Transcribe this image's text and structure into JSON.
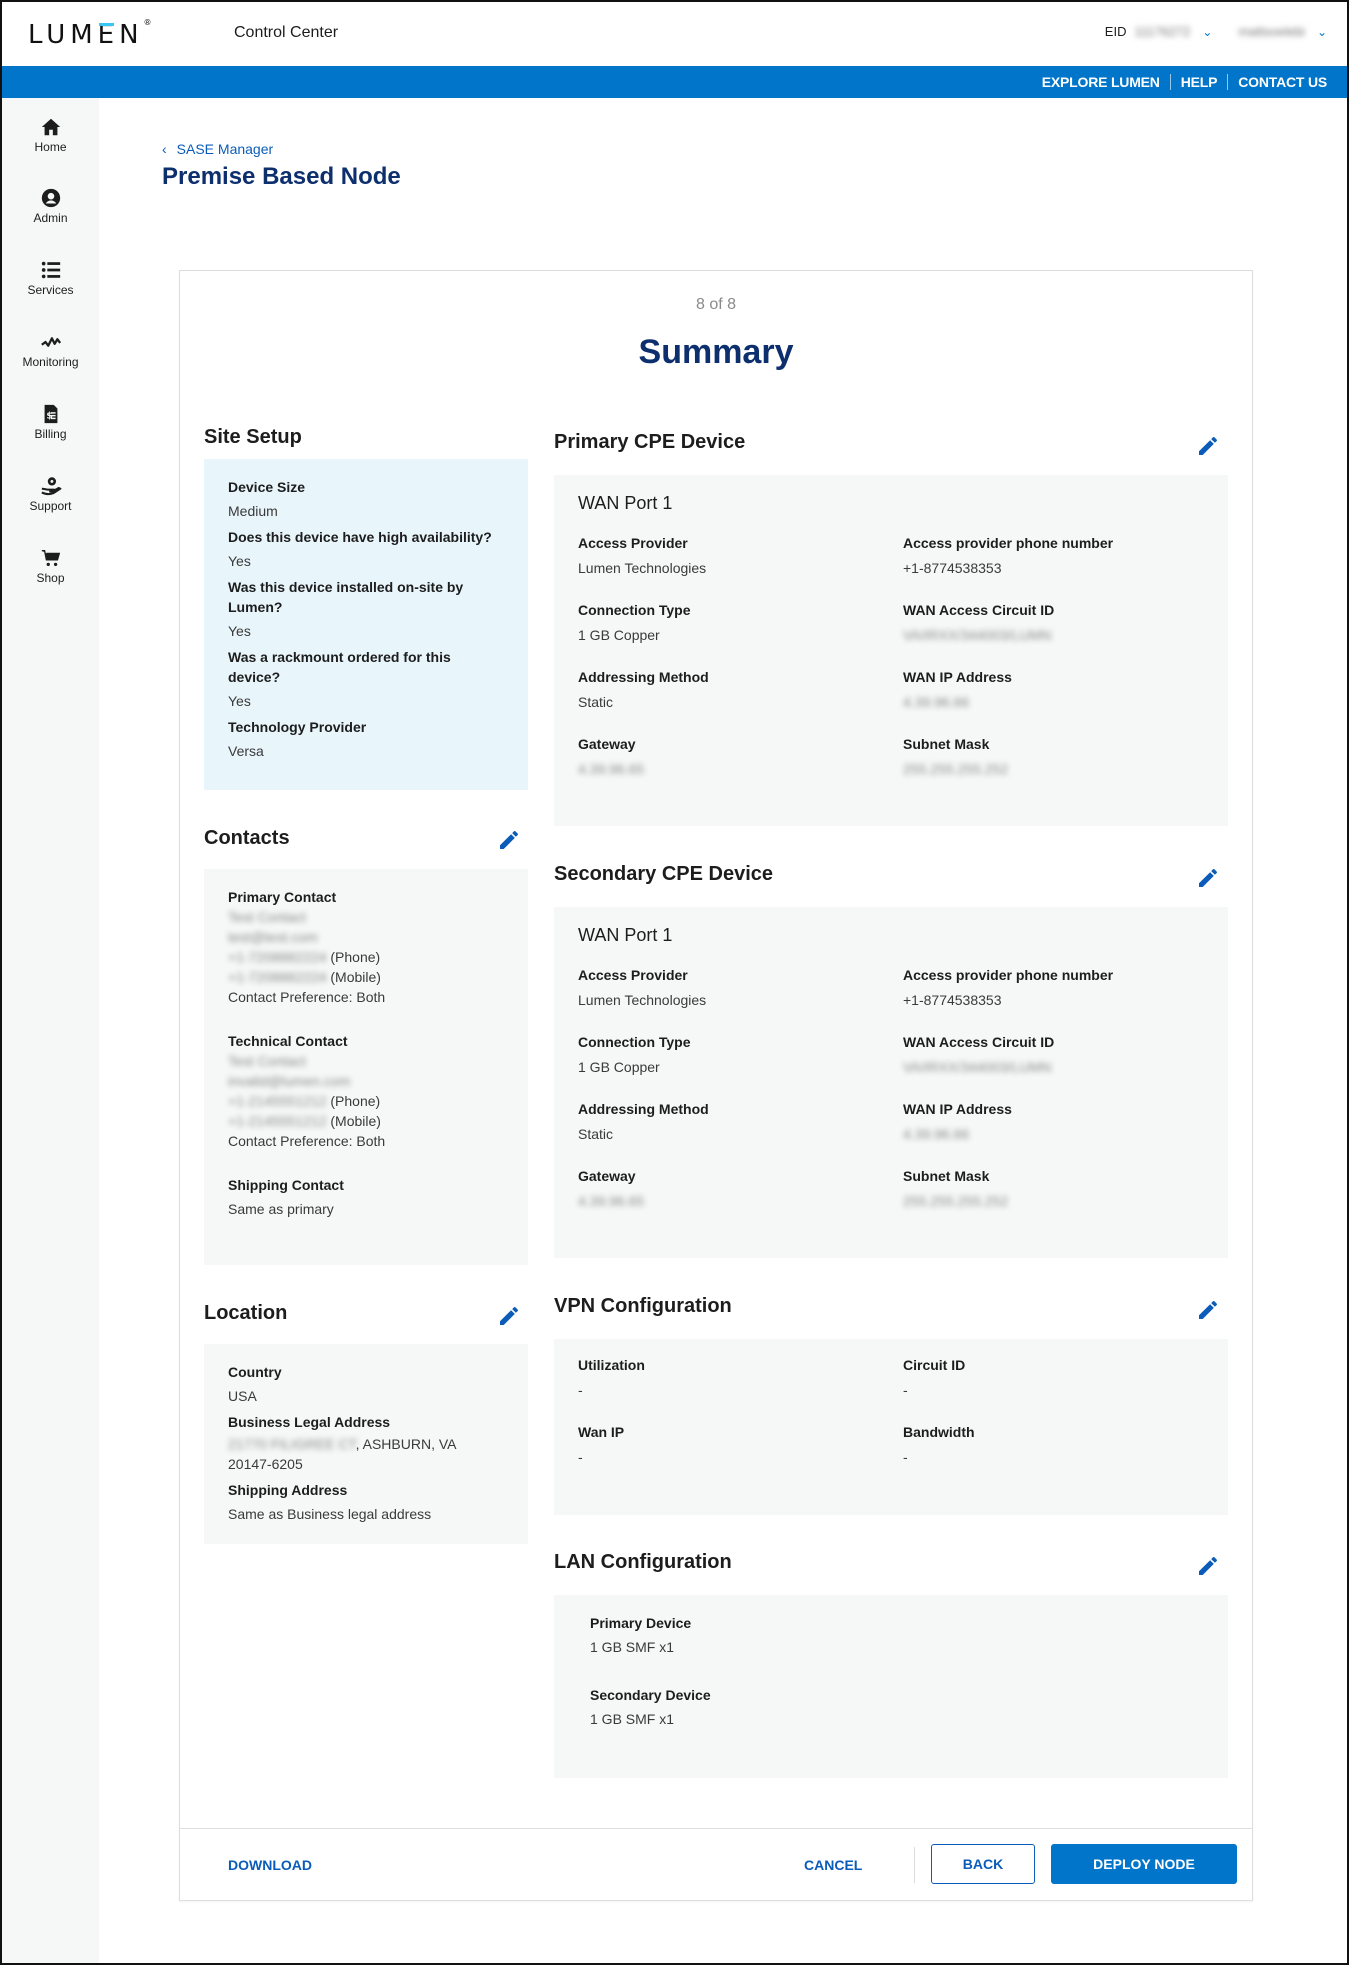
{
  "header": {
    "logo": "LUMEN",
    "app_name": "Control Center",
    "eid_label": "EID",
    "eid_value": "11176272",
    "user_name": "mattsoelebi"
  },
  "topnav": {
    "links": [
      "EXPLORE LUMEN",
      "HELP",
      "CONTACT US"
    ]
  },
  "sidebar": {
    "items": [
      {
        "label": "Home",
        "icon": "home-icon"
      },
      {
        "label": "Admin",
        "icon": "user-circle-icon"
      },
      {
        "label": "Services",
        "icon": "list-icon"
      },
      {
        "label": "Monitoring",
        "icon": "pulse-icon"
      },
      {
        "label": "Billing",
        "icon": "invoice-icon"
      },
      {
        "label": "Support",
        "icon": "support-icon"
      },
      {
        "label": "Shop",
        "icon": "cart-icon"
      }
    ]
  },
  "page": {
    "breadcrumb": "SASE Manager",
    "title": "Premise Based Node",
    "step": "8 of 8",
    "summary_title": "Summary"
  },
  "site_setup": {
    "title": "Site Setup",
    "fields": [
      {
        "label": "Device Size",
        "value": "Medium"
      },
      {
        "label": "Does this device have high availability?",
        "value": "Yes"
      },
      {
        "label": "Was this device installed on-site by Lumen?",
        "value": "Yes"
      },
      {
        "label": "Was a rackmount ordered for this device?",
        "value": "Yes"
      },
      {
        "label": "Technology Provider",
        "value": "Versa"
      }
    ]
  },
  "contacts": {
    "title": "Contacts",
    "primary": {
      "label": "Primary Contact",
      "name": "Test Contact",
      "email": "test@test.com",
      "phone": "+1-7208882224",
      "phone_suffix": "(Phone)",
      "mobile": "+1-7208882224",
      "mobile_suffix": "(Mobile)",
      "preference": "Contact Preference: Both"
    },
    "technical": {
      "label": "Technical Contact",
      "name": "Test Contact",
      "email": "invalid@lumen.com",
      "phone": "+1-2145551212",
      "phone_suffix": "(Phone)",
      "mobile": "+1-2145551212",
      "mobile_suffix": "(Mobile)",
      "preference": "Contact Preference: Both"
    },
    "shipping": {
      "label": "Shipping Contact",
      "value": "Same as primary"
    }
  },
  "location": {
    "title": "Location",
    "country_label": "Country",
    "country": "USA",
    "business_label": "Business Legal Address",
    "street": "21770 FILIGREE CT",
    "city_state": ", ASHBURN, VA",
    "zip": "20147-6205",
    "shipping_label": "Shipping Address",
    "shipping_value": "Same as Business legal address"
  },
  "primary_cpe": {
    "title": "Primary CPE Device",
    "wan_title": "WAN Port 1",
    "fields": [
      {
        "label": "Access Provider",
        "value": "Lumen Technologies",
        "blurred": false
      },
      {
        "label": "Access provider phone number",
        "value": "+1-8774538353",
        "blurred": false
      },
      {
        "label": "Connection Type",
        "value": "1 GB Copper",
        "blurred": false
      },
      {
        "label": "WAN Access Circuit ID",
        "value": "VA/IRXX/344003/LUMN",
        "blurred": true
      },
      {
        "label": "Addressing Method",
        "value": "Static",
        "blurred": false
      },
      {
        "label": "WAN IP Address",
        "value": "4.39.96.66",
        "blurred": true
      },
      {
        "label": "Gateway",
        "value": "4.39.96.65",
        "blurred": true
      },
      {
        "label": "Subnet Mask",
        "value": "255.255.255.252",
        "blurred": true
      }
    ]
  },
  "secondary_cpe": {
    "title": "Secondary CPE Device",
    "wan_title": "WAN Port 1",
    "fields": [
      {
        "label": "Access Provider",
        "value": "Lumen Technologies",
        "blurred": false
      },
      {
        "label": "Access provider phone number",
        "value": "+1-8774538353",
        "blurred": false
      },
      {
        "label": "Connection Type",
        "value": "1 GB Copper",
        "blurred": false
      },
      {
        "label": "WAN Access Circuit ID",
        "value": "VA/IRXX/344003/LUMN",
        "blurred": true
      },
      {
        "label": "Addressing Method",
        "value": "Static",
        "blurred": false
      },
      {
        "label": "WAN IP Address",
        "value": "4.39.96.66",
        "blurred": true
      },
      {
        "label": "Gateway",
        "value": "4.39.96.65",
        "blurred": true
      },
      {
        "label": "Subnet Mask",
        "value": "255.255.255.252",
        "blurred": true
      }
    ]
  },
  "vpn": {
    "title": "VPN Configuration",
    "fields": [
      {
        "label": "Utilization",
        "value": "-"
      },
      {
        "label": "Circuit ID",
        "value": "-"
      },
      {
        "label": "Wan IP",
        "value": "-"
      },
      {
        "label": "Bandwidth",
        "value": "-"
      }
    ]
  },
  "lan": {
    "title": "LAN Configuration",
    "fields": [
      {
        "label": "Primary Device",
        "value": "1 GB SMF x1"
      },
      {
        "label": "Secondary Device",
        "value": "1 GB SMF x1"
      }
    ]
  },
  "footer": {
    "download": "DOWNLOAD",
    "cancel": "CANCEL",
    "back": "BACK",
    "deploy": "DEPLOY NODE"
  },
  "colors": {
    "brand_blue": "#0075c9",
    "title_navy": "#0d2f6e",
    "link_blue": "#0a5cb8",
    "site_setup_bg": "#e8f5fb",
    "panel_bg": "#f6f8f8"
  }
}
